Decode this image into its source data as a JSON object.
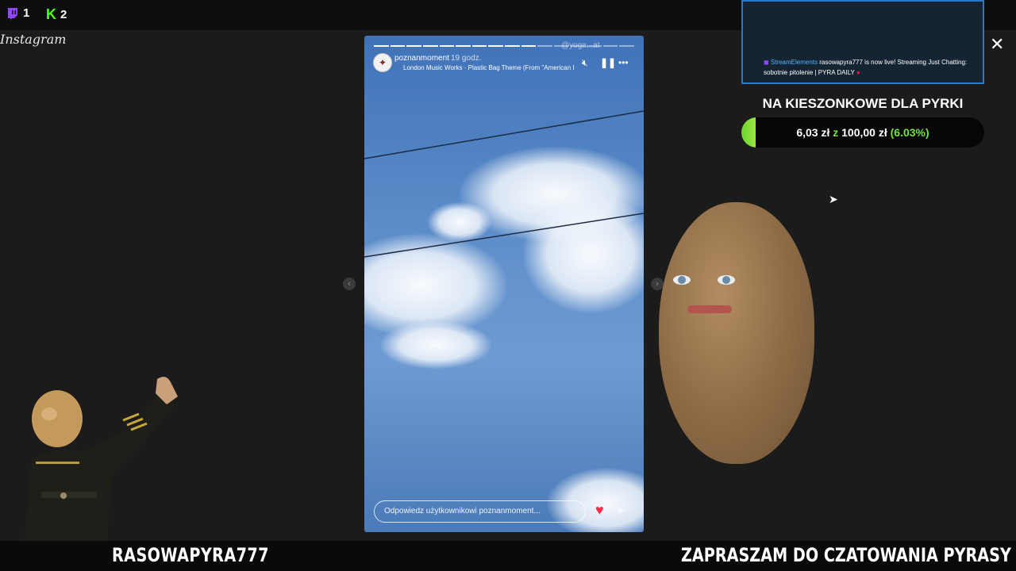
{
  "top": {
    "twitch_count": "1",
    "kick_count": "2",
    "twitch_icon": "twitch-icon",
    "kick_icon": "kick-icon",
    "kick_letter": "K"
  },
  "instagram": {
    "logo_text": "Instagram"
  },
  "story": {
    "username": "poznanmoment",
    "time_ago": "19 godz.",
    "music": "London Music Works · Plastic Bag Theme (From \"American I",
    "reply_placeholder": "Odpowiedz użytkownikowi poznanmoment...",
    "reply_tag": "@yoga...at",
    "progress_segments": 16,
    "progress_done": 10
  },
  "alert": {
    "source": "StreamElements",
    "message": "rasowapyra777 is now live! Streaming Just Chatting: sobotnie pitolenie | PYRA DAILY"
  },
  "goal": {
    "title": "NA KIESZONKOWE DLA PYRKI",
    "current": "6,03 zł",
    "separator": "z",
    "target": "100,00 zł",
    "percent_label": "(6.03%)",
    "percent": 6.03
  },
  "bottom": {
    "nickname": "RASOWAPYRA777",
    "ticker": "ZAPRASZAM DO CZATOWANIA PYRASY"
  },
  "colors": {
    "goal_green": "#6fe33b",
    "cam_border": "#2b77c8",
    "twitch_purple": "#9146ff",
    "kick_green": "#53fc18"
  }
}
